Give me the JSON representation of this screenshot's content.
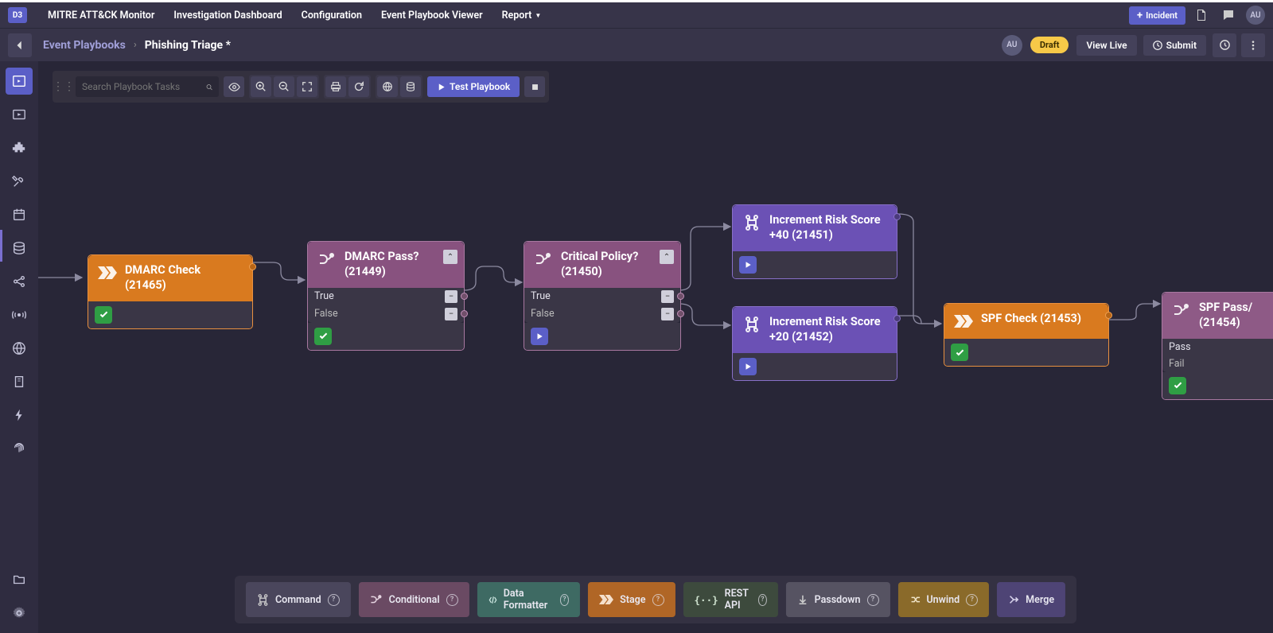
{
  "topnav": {
    "logo": "D3",
    "items": [
      "MITRE ATT&CK Monitor",
      "Investigation Dashboard",
      "Configuration",
      "Event Playbook Viewer",
      "Report"
    ],
    "incident_btn": "Incident",
    "avatar": "AU"
  },
  "subhead": {
    "crumb1": "Event Playbooks",
    "crumb2": "Phishing Triage *",
    "avatar": "AU",
    "draft": "Draft",
    "view_live": "View Live",
    "submit": "Submit"
  },
  "toolbar": {
    "search_placeholder": "Search Playbook Tasks",
    "test_btn": "Test Playbook"
  },
  "nodes": {
    "dmarc_check": {
      "title": "DMARC Check (21465)"
    },
    "dmarc_pass": {
      "title": "DMARC Pass? (21449)",
      "opt_true": "True",
      "opt_false": "False"
    },
    "critical_policy": {
      "title": "Critical Policy? (21450)",
      "opt_true": "True",
      "opt_false": "False"
    },
    "incr40": {
      "title": "Increment Risk Score +40 (21451)"
    },
    "incr20": {
      "title": "Increment Risk Score +20 (21452)"
    },
    "spf_check": {
      "title": "SPF Check (21453)"
    },
    "spf_pass": {
      "title": "SPF Pass/ (21454)",
      "opt_pass": "Pass",
      "opt_fail": "Fail"
    }
  },
  "palette": {
    "command": "Command",
    "conditional": "Conditional",
    "formatter": "Data Formatter",
    "stage": "Stage",
    "restapi": "REST API",
    "passdown": "Passdown",
    "unwind": "Unwind",
    "merge": "Merge"
  }
}
